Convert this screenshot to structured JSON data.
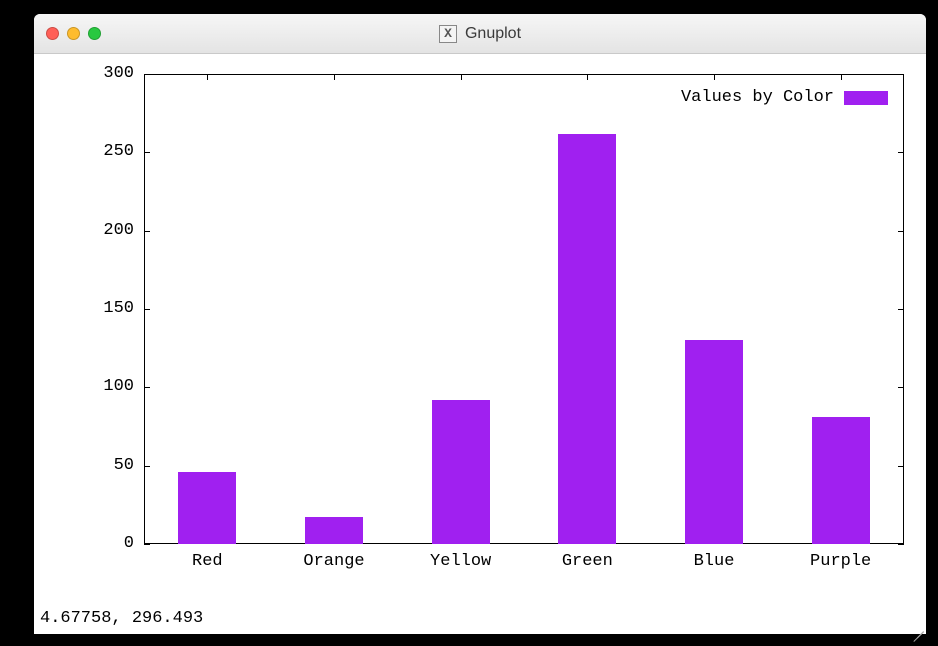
{
  "window": {
    "title": "Gnuplot",
    "x11_icon_label": "X"
  },
  "chart_data": {
    "type": "bar",
    "categories": [
      "Red",
      "Orange",
      "Yellow",
      "Green",
      "Blue",
      "Purple"
    ],
    "values": [
      46,
      17,
      92,
      262,
      130,
      81
    ],
    "series_name": "Values by Color",
    "ylim": [
      0,
      300
    ],
    "yticks": [
      0,
      50,
      100,
      150,
      200,
      250,
      300
    ],
    "bar_color": "#a020f0"
  },
  "status": {
    "coords": "4.67758,  296.493"
  }
}
